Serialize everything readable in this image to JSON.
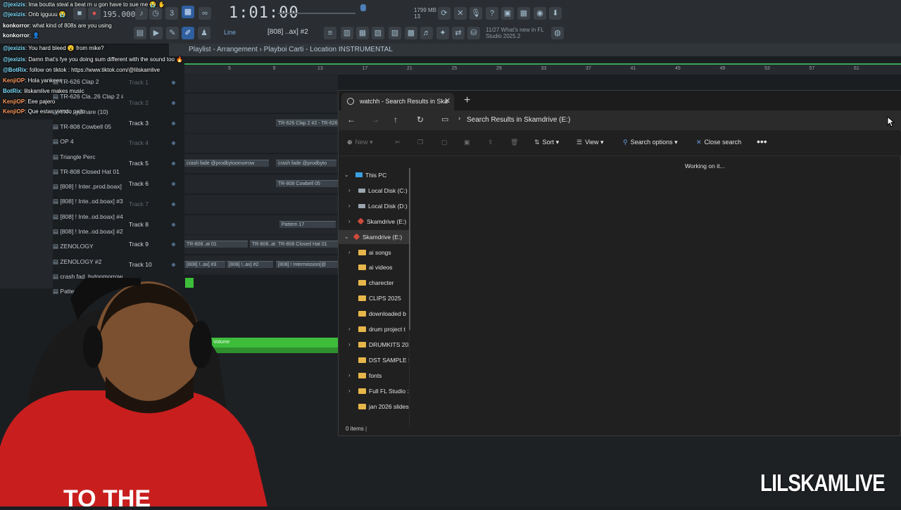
{
  "fl": {
    "time": "1:01:00",
    "bpm": "195.000",
    "cpu_line1": "1799 MB",
    "cpu_line2": "13",
    "hint": "11/27 What's new in FL Studio 2025.2",
    "pattern_selector": "[808] ..ax] #2",
    "line_mode": "Line",
    "playlist_title": "Playlist - Arrangement  ›  Playboi Carti - Location INSTRUMENTAL",
    "ruler": [
      "5",
      "9",
      "13",
      "17",
      "21",
      "25",
      "29",
      "33",
      "37",
      "41",
      "45",
      "49",
      "53",
      "57",
      "61"
    ],
    "channels": [
      "TR-626 Clap 2",
      "TR-626 Cla..26 Clap 2 #2",
      "TR-...g Snare (10)",
      "TR-808 Cowbell 05",
      "OP 4",
      "Triangle Perc",
      "TR-808 Closed Hat 01",
      "[808] ! Inter..prod.boax]",
      "[808] ! Inte..od.boax] #3",
      "[808] ! Inte..od.boax] #4",
      "[808] ! Inte..od.boax] #2",
      "ZENOLOGY",
      "ZENOLOGY #2",
      "crash fad..bytoomorrow",
      "Pattern 17"
    ],
    "tracks": [
      "Track 1",
      "Track 2",
      "Track 3",
      "Track 4",
      "Track 5",
      "Track 6",
      "Track 7",
      "Track 8",
      "Track 9",
      "Track 10"
    ],
    "clips": [
      {
        "label": "TR-626 Clap 2 #2 - TR-626",
        "track": 3
      },
      {
        "label": "crash fade @prodbytoomorrow",
        "track": 5
      },
      {
        "label": "crash fade @prodbyto",
        "track": 5
      },
      {
        "label": "TR-808 Cowbell 05",
        "track": 6
      },
      {
        "label": "Pattern 17",
        "track": 8
      },
      {
        "label": "TR-808..at 01",
        "track": 9
      },
      {
        "label": "TR-808..at 01",
        "track": 9
      },
      {
        "label": "TR-808 Closed Hat 01",
        "track": 9
      },
      {
        "label": "[808] !..ax] #3",
        "track": 10
      },
      {
        "label": "[808] !..ax] #2",
        "track": 10
      },
      {
        "label": "[808] ! Intermission[@",
        "track": 10
      }
    ],
    "volume_clip": "Volume"
  },
  "chat": [
    {
      "user": "@jexizis",
      "text": ": Ima boutta steal a beat rn u gon have to sue me 😭 ✋",
      "color": "#7fe0ff"
    },
    {
      "user": "@jexizis",
      "text": ": Onb igguuu 😭",
      "color": "#7fe0ff"
    },
    {
      "user": "konkorror",
      "text": ": what kind of 808s are you using",
      "color": "#ffffff"
    },
    {
      "user": "konkorror",
      "text": ": 👤",
      "color": "#ffffff"
    },
    {
      "user": "@jexizis",
      "text": ": You hard bleed 😮 from mike?",
      "color": "#7fe0ff"
    },
    {
      "user": "@jexizis",
      "text": ": Damn that's fye you doing sum different with the sound too 🔥",
      "color": "#7fe0ff"
    },
    {
      "user": "@BotRix",
      "text": ": follow on tiktok : https://www.tiktok.com/@lilskamlive",
      "color": "#7fe0ff"
    },
    {
      "user": "KenjiOP",
      "text": ": Hola yankees",
      "color": "#ff9a5a"
    },
    {
      "user": "BotRix",
      "text": ": lilskamlive makes music",
      "color": "#7fe0ff"
    },
    {
      "user": "KenjiOP",
      "text": ": Eee pajero",
      "color": "#ff9a5a"
    },
    {
      "user": "KenjiOP",
      "text": ": Que estas viendo pajin",
      "color": "#ff9a5a"
    }
  ],
  "explorer": {
    "tab_title": "watchh - Search Results in Ska",
    "address": "Search Results in Skamdrive (E:)",
    "toolbar": {
      "new": "New",
      "sort": "Sort",
      "view": "View",
      "search_options": "Search options",
      "close_search": "Close search"
    },
    "tree": [
      {
        "label": "This PC",
        "kind": "pc",
        "indent": 0,
        "expanded": true
      },
      {
        "label": "Local Disk (C:)",
        "kind": "drive",
        "indent": 1,
        "expanded": false
      },
      {
        "label": "Local Disk (D:)",
        "kind": "drive",
        "indent": 1,
        "expanded": false
      },
      {
        "label": "Skamdrive (E:)",
        "kind": "drive-red",
        "indent": 1,
        "expanded": false
      },
      {
        "label": "Skamdrive (E:)",
        "kind": "drive-red",
        "indent": 0,
        "expanded": true
      },
      {
        "label": "ai songs",
        "kind": "folder",
        "indent": 1,
        "expanded": false
      },
      {
        "label": "ai videos",
        "kind": "folder",
        "indent": 1,
        "expanded": null
      },
      {
        "label": "charecter",
        "kind": "folder",
        "indent": 1,
        "expanded": null
      },
      {
        "label": "CLIPS 2025",
        "kind": "folder",
        "indent": 1,
        "expanded": null
      },
      {
        "label": "downloaded b",
        "kind": "folder",
        "indent": 1,
        "expanded": null
      },
      {
        "label": "drum project t",
        "kind": "folder",
        "indent": 1,
        "expanded": false
      },
      {
        "label": "DRUMKITS 202",
        "kind": "folder",
        "indent": 1,
        "expanded": false
      },
      {
        "label": "DST SAMPLE S",
        "kind": "folder",
        "indent": 1,
        "expanded": null
      },
      {
        "label": "fonts",
        "kind": "folder",
        "indent": 1,
        "expanded": false
      },
      {
        "label": "Full FL Studio :",
        "kind": "folder",
        "indent": 1,
        "expanded": false
      },
      {
        "label": "jan 2026 slides",
        "kind": "folder",
        "indent": 1,
        "expanded": null
      }
    ],
    "working_text": "Working on it...",
    "status": "0 items"
  },
  "watermark": "LILSKAMLIVE",
  "webcam_shirt_text": "TO THE"
}
